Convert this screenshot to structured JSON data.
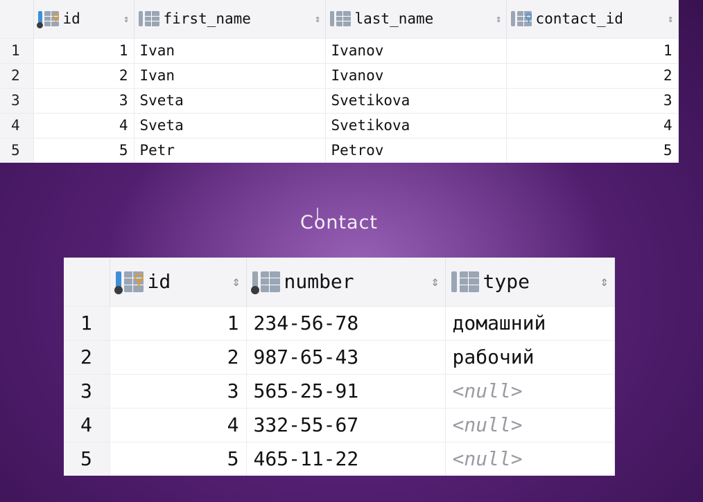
{
  "person_table": {
    "columns": [
      {
        "name": "id",
        "icon": "primary-key-icon"
      },
      {
        "name": "first_name",
        "icon": "column-icon"
      },
      {
        "name": "last_name",
        "icon": "column-icon"
      },
      {
        "name": "contact_id",
        "icon": "foreign-key-icon"
      }
    ],
    "sort_glyph": "⇕",
    "rows": [
      {
        "n": "1",
        "id": "1",
        "first_name": "Ivan",
        "last_name": "Ivanov",
        "contact_id": "1"
      },
      {
        "n": "2",
        "id": "2",
        "first_name": "Ivan",
        "last_name": "Ivanov",
        "contact_id": "2"
      },
      {
        "n": "3",
        "id": "3",
        "first_name": "Sveta",
        "last_name": "Svetikova",
        "contact_id": "3"
      },
      {
        "n": "4",
        "id": "4",
        "first_name": "Sveta",
        "last_name": "Svetikova",
        "contact_id": "4"
      },
      {
        "n": "5",
        "id": "5",
        "first_name": "Petr",
        "last_name": "Petrov",
        "contact_id": "5"
      }
    ]
  },
  "caption": "Contact",
  "contact_table": {
    "columns": [
      {
        "name": "id",
        "icon": "primary-key-icon"
      },
      {
        "name": "number",
        "icon": "column-icon"
      },
      {
        "name": "type",
        "icon": "column-icon"
      }
    ],
    "rows": [
      {
        "n": "1",
        "id": "1",
        "number": "234-56-78",
        "type": "домашний"
      },
      {
        "n": "2",
        "id": "2",
        "number": "987-65-43",
        "type": "рабочий"
      },
      {
        "n": "3",
        "id": "3",
        "number": "565-25-91",
        "type": "<null>"
      },
      {
        "n": "4",
        "id": "4",
        "number": "332-55-67",
        "type": "<null>"
      },
      {
        "n": "5",
        "id": "5",
        "number": "465-11-22",
        "type": "<null>"
      }
    ]
  },
  "colors": {
    "background": "#4a1a66",
    "key_icon": "#e89a18",
    "pk_bar": "#3f8fd8",
    "null_text": "#9a9aa2"
  }
}
